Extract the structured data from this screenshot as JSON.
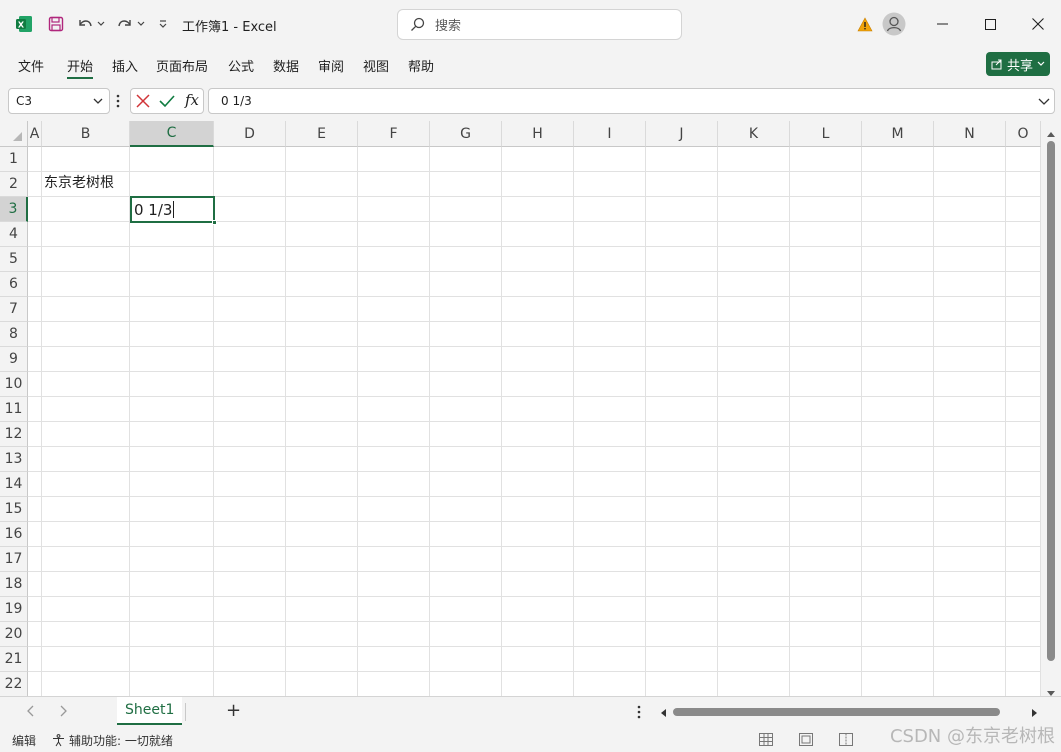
{
  "app": {
    "title": "工作簿1  -  Excel",
    "search_placeholder": "搜索",
    "share_label": "共享"
  },
  "menu": [
    "文件",
    "开始",
    "插入",
    "页面布局",
    "公式",
    "数据",
    "审阅",
    "视图",
    "帮助"
  ],
  "formula_bar": {
    "name_box": "C3",
    "fx_label": "fx",
    "formula": "0 1/3"
  },
  "columns": [
    "A",
    "B",
    "C",
    "D",
    "E",
    "F",
    "G",
    "H",
    "I",
    "J",
    "K",
    "L",
    "M",
    "N",
    "O"
  ],
  "rows": [
    "1",
    "2",
    "3",
    "4",
    "5",
    "6",
    "7",
    "8",
    "9",
    "10",
    "11",
    "12",
    "13",
    "14",
    "15",
    "16",
    "17",
    "18",
    "19",
    "20",
    "21",
    "22"
  ],
  "cells": {
    "B2": "东京老树根",
    "C3": "0 1/3"
  },
  "sheets": {
    "active": "Sheet1",
    "add_label": "+"
  },
  "status": {
    "mode": "编辑",
    "accessibility": "辅助功能: 一切就绪"
  },
  "watermark": "CSDN @东京老树根",
  "colors": {
    "accent": "#1f6e43",
    "grid_line": "#e1e1e1"
  }
}
